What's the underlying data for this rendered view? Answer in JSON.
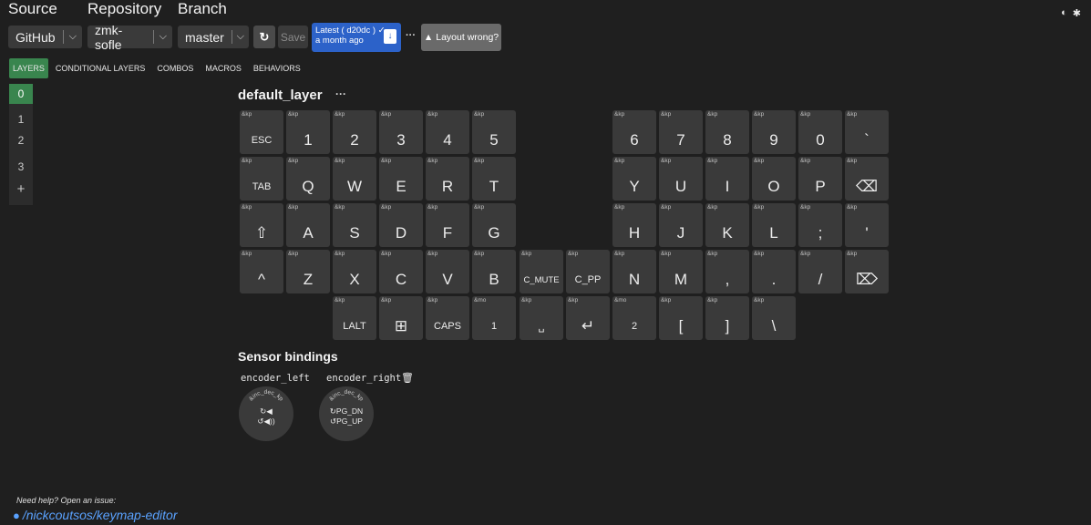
{
  "header": {
    "source_label": "Source",
    "repository_label": "Repository",
    "branch_label": "Branch",
    "source_value": "GitHub",
    "repository_value": "zmk-sofle",
    "branch_value": "master",
    "save_label": "Save",
    "latest_line1": "Latest ( d20dc ) ✓",
    "latest_line2": "a month ago",
    "more_label": "···",
    "layout_wrong_label": "Layout wrong?"
  },
  "tabs": [
    "LAYERS",
    "CONDITIONAL LAYERS",
    "COMBOS",
    "MACROS",
    "BEHAVIORS"
  ],
  "layers": [
    "0",
    "1",
    "2",
    "3",
    "+"
  ],
  "layer": {
    "name": "default_layer",
    "more": "···"
  },
  "keys": [
    {
      "b": "&kp",
      "p": "ESC",
      "s": "small"
    },
    {
      "b": "&kp",
      "p": "1"
    },
    {
      "b": "&kp",
      "p": "2"
    },
    {
      "b": "&kp",
      "p": "3"
    },
    {
      "b": "&kp",
      "p": "4"
    },
    {
      "b": "&kp",
      "p": "5"
    },
    {
      "b": "&kp",
      "p": "6"
    },
    {
      "b": "&kp",
      "p": "7"
    },
    {
      "b": "&kp",
      "p": "8"
    },
    {
      "b": "&kp",
      "p": "9"
    },
    {
      "b": "&kp",
      "p": "0"
    },
    {
      "b": "&kp",
      "p": "`"
    },
    {
      "b": "&kp",
      "p": "TAB",
      "s": "small"
    },
    {
      "b": "&kp",
      "p": "Q"
    },
    {
      "b": "&kp",
      "p": "W"
    },
    {
      "b": "&kp",
      "p": "E"
    },
    {
      "b": "&kp",
      "p": "R"
    },
    {
      "b": "&kp",
      "p": "T"
    },
    {
      "b": "&kp",
      "p": "Y"
    },
    {
      "b": "&kp",
      "p": "U"
    },
    {
      "b": "&kp",
      "p": "I"
    },
    {
      "b": "&kp",
      "p": "O"
    },
    {
      "b": "&kp",
      "p": "P"
    },
    {
      "b": "&kp",
      "p": "⌫"
    },
    {
      "b": "&kp",
      "p": "⇧"
    },
    {
      "b": "&kp",
      "p": "A"
    },
    {
      "b": "&kp",
      "p": "S"
    },
    {
      "b": "&kp",
      "p": "D"
    },
    {
      "b": "&kp",
      "p": "F"
    },
    {
      "b": "&kp",
      "p": "G"
    },
    {
      "b": "&kp",
      "p": "H"
    },
    {
      "b": "&kp",
      "p": "J"
    },
    {
      "b": "&kp",
      "p": "K"
    },
    {
      "b": "&kp",
      "p": "L"
    },
    {
      "b": "&kp",
      "p": ";"
    },
    {
      "b": "&kp",
      "p": "'"
    },
    {
      "b": "&kp",
      "p": "^"
    },
    {
      "b": "&kp",
      "p": "Z"
    },
    {
      "b": "&kp",
      "p": "X"
    },
    {
      "b": "&kp",
      "p": "C"
    },
    {
      "b": "&kp",
      "p": "V"
    },
    {
      "b": "&kp",
      "p": "B"
    },
    {
      "b": "&kp",
      "p": "C_MUTE",
      "s": "xs"
    },
    {
      "b": "&kp",
      "p": "C_PP",
      "s": "small"
    },
    {
      "b": "&kp",
      "p": "N"
    },
    {
      "b": "&kp",
      "p": "M"
    },
    {
      "b": "&kp",
      "p": ","
    },
    {
      "b": "&kp",
      "p": "."
    },
    {
      "b": "&kp",
      "p": "/"
    },
    {
      "b": "&kp",
      "p": "⌦"
    },
    {
      "b": "&kp",
      "p": "LALT",
      "s": "small"
    },
    {
      "b": "&kp",
      "p": "⊞"
    },
    {
      "b": "&kp",
      "p": "CAPS",
      "s": "small"
    },
    {
      "b": "&mo",
      "p": "1",
      "s": "small"
    },
    {
      "b": "&kp",
      "p": "␣",
      "s": "small"
    },
    {
      "b": "&kp",
      "p": "↵"
    },
    {
      "b": "&mo",
      "p": "2",
      "s": "small"
    },
    {
      "b": "&kp",
      "p": "["
    },
    {
      "b": "&kp",
      "p": "]"
    },
    {
      "b": "&kp",
      "p": "\\"
    }
  ],
  "sensor_bindings": {
    "title": "Sensor bindings",
    "encoders": [
      {
        "name": "encoder_left",
        "behavior": "&inc_dec_kp",
        "cw": "↻◀",
        "ccw": "↺◀))"
      },
      {
        "name": "encoder_right",
        "behavior": "&inc_dec_kp",
        "cw": "↻PG_DN",
        "ccw": "↺PG_UP"
      }
    ]
  },
  "footer": {
    "help_text": "Need help? Open an issue:",
    "repo_link": "/nickcoutsos/keymap-editor"
  }
}
